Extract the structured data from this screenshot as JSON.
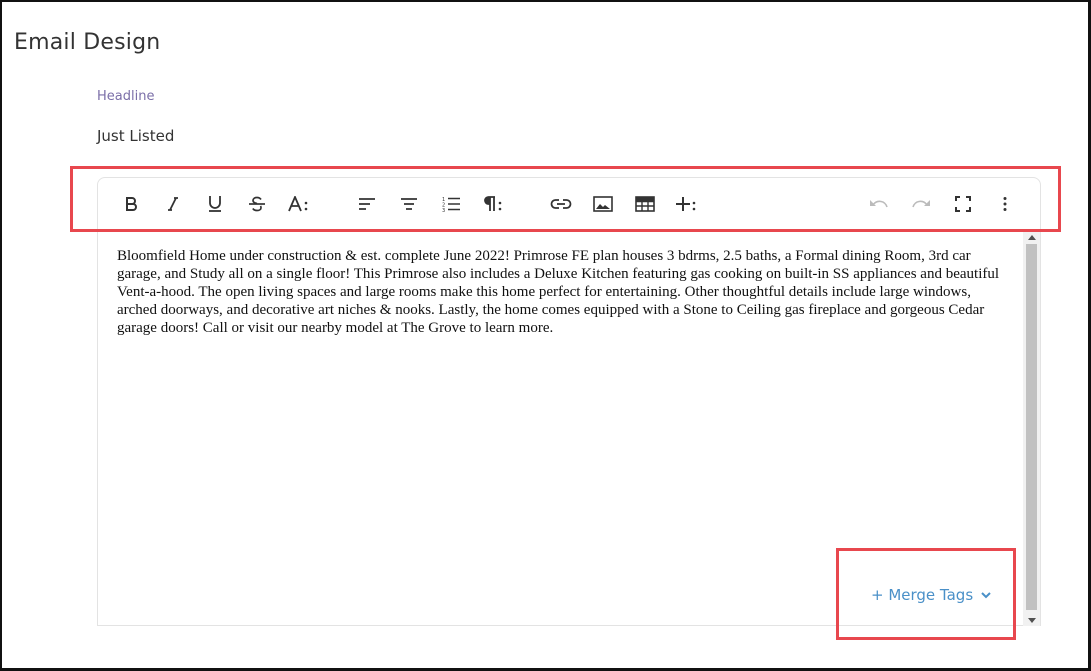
{
  "page": {
    "title": "Email Design"
  },
  "headline": {
    "label": "Headline",
    "value": "Just Listed"
  },
  "toolbar": {
    "buttons": [
      {
        "name": "bold",
        "icon": "bold-icon"
      },
      {
        "name": "italic",
        "icon": "italic-icon"
      },
      {
        "name": "underline",
        "icon": "underline-icon"
      },
      {
        "name": "strikethrough",
        "icon": "strikethrough-icon"
      },
      {
        "name": "text-format-more",
        "icon": "text-format-icon"
      },
      {
        "name": "align-left",
        "icon": "align-left-icon"
      },
      {
        "name": "align-center",
        "icon": "align-center-icon"
      },
      {
        "name": "ordered-list",
        "icon": "ordered-list-icon"
      },
      {
        "name": "paragraph-format-more",
        "icon": "paragraph-icon"
      },
      {
        "name": "insert-link",
        "icon": "link-icon"
      },
      {
        "name": "insert-image",
        "icon": "image-icon"
      },
      {
        "name": "insert-table",
        "icon": "table-icon"
      },
      {
        "name": "insert-more",
        "icon": "plus-more-icon"
      },
      {
        "name": "undo",
        "icon": "undo-icon"
      },
      {
        "name": "redo",
        "icon": "redo-icon"
      },
      {
        "name": "fullscreen",
        "icon": "fullscreen-icon"
      },
      {
        "name": "more-options",
        "icon": "kebab-menu-icon"
      }
    ]
  },
  "editor": {
    "body_text": "Bloomfield Home under construction & est. complete June 2022! Primrose FE plan houses 3 bdrms, 2.5 baths, a Formal dining Room, 3rd car garage, and Study all on a single floor! This Primrose also includes a Deluxe Kitchen featuring gas cooking on built-in SS appliances and beautiful Vent-a-hood. The open living spaces and large rooms make this home perfect for entertaining. Other thoughtful details include large windows, arched doorways, and decorative art niches & nooks. Lastly, the home comes equipped with a Stone to Ceiling gas fireplace and gorgeous Cedar garage doors! Call or visit our nearby model at The Grove to learn more."
  },
  "merge_tags": {
    "label": "+ Merge Tags",
    "icon": "chevron-down-icon"
  },
  "colors": {
    "accent_link": "#4a90c8",
    "label_purple": "#7b6fa8",
    "highlight_red": "#e8474e"
  }
}
